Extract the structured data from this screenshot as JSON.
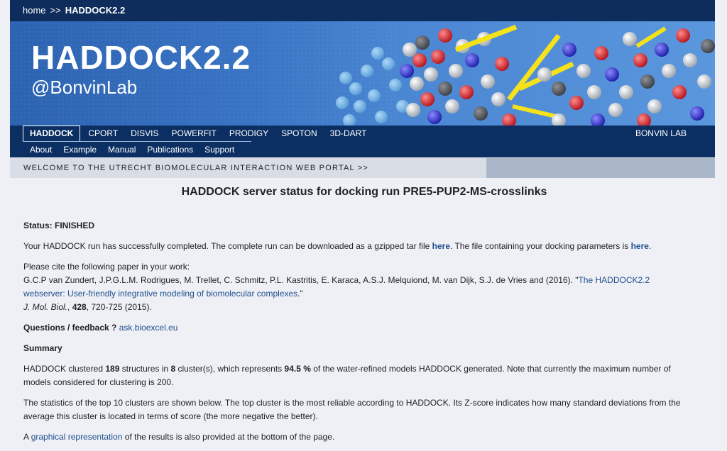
{
  "breadcrumb": {
    "home": "home",
    "separator": ">>",
    "current": "HADDOCK2.2"
  },
  "banner": {
    "title": "HADDOCK2.2",
    "subtitle": "@BonvinLab"
  },
  "nav": {
    "top_items": [
      "HADDOCK",
      "CPORT",
      "DISVIS",
      "POWERFIT",
      "PRODIGY",
      "SPOTON",
      "3D-DART"
    ],
    "right_label": "BONVIN LAB",
    "bottom_items": [
      "About",
      "Example",
      "Manual",
      "Publications",
      "Support"
    ]
  },
  "welcome": "WELCOME TO THE UTRECHT BIOMOLECULAR INTERACTION WEB PORTAL >>",
  "page_title": "HADDOCK server status for docking run PRE5-PUP2-MS-crosslinks",
  "status": {
    "label": "Status: FINISHED"
  },
  "run_complete": {
    "text1": "Your HADDOCK run has successfully completed. The complete run can be downloaded as a gzipped tar file ",
    "link1": "here",
    "text2": ". The file containing your docking parameters is ",
    "link2": "here",
    "text3": "."
  },
  "cite": {
    "intro": "Please cite the following paper in your work:",
    "authors": "G.C.P van Zundert, J.P.G.L.M. Rodrigues, M. Trellet, C. Schmitz, P.L. Kastritis, E. Karaca, A.S.J. Melquiond, M. van Dijk, S.J. de Vries and (2016). \"",
    "title_line1": "The HADDOCK2.2",
    "title_line2": "webserver: User-friendly integrative modeling of biomolecular complexes",
    "title_end": ".\"",
    "journal": "J. Mol. Biol.",
    "volume": "428",
    "pages": ", 720-725 (2015)."
  },
  "feedback": {
    "label": "Questions / feedback ?",
    "link": "ask.bioexcel.eu"
  },
  "summary": {
    "heading": "Summary",
    "p1_a": "HADDOCK clustered ",
    "structures": "189",
    "p1_b": " structures in ",
    "clusters": "8",
    "p1_c": " cluster(s), which represents ",
    "percent": "94.5 %",
    "p1_d": " of the water-refined models HADDOCK generated. Note that currently the maximum number of",
    "p1_e": "models considered for clustering is 200.",
    "p2_a": "The statistics of the top 10 clusters are shown below. The top cluster is the most reliable according to HADDOCK. Its Z-score indicates how many standard deviations from the",
    "p2_b": "average this cluster is located in terms of score (the more negative the better).",
    "p3_a": "A ",
    "p3_link": "graphical representation",
    "p3_b": " of the results is also provided at the bottom of the page."
  }
}
